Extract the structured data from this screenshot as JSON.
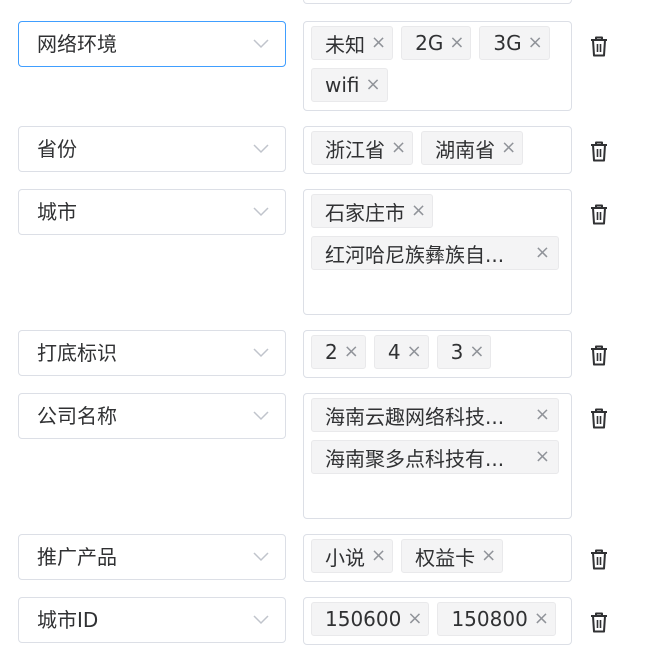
{
  "rows": [
    {
      "field": "网络环境",
      "tags": [
        "未知",
        "2G",
        "3G",
        "wifi"
      ]
    },
    {
      "field": "省份",
      "tags": [
        "浙江省",
        "湖南省"
      ]
    },
    {
      "field": "城市",
      "tags": [
        "石家庄市",
        "红河哈尼族彝族自..."
      ]
    },
    {
      "field": "打底标识",
      "tags": [
        "2",
        "4",
        "3"
      ]
    },
    {
      "field": "公司名称",
      "tags": [
        "海南云趣网络科技...",
        "海南聚多点科技有..."
      ]
    },
    {
      "field": "推广产品",
      "tags": [
        "小说",
        "权益卡"
      ]
    },
    {
      "field": "城市ID",
      "tags": [
        "150600",
        "150800"
      ]
    }
  ],
  "icons": {
    "dropdown": "chevron-down-icon",
    "delete": "trash-icon",
    "remove_tag": "close-icon"
  },
  "colors": {
    "focus_border": "#409eff",
    "tag_bg": "#f4f4f5",
    "border": "#dcdfe6"
  }
}
